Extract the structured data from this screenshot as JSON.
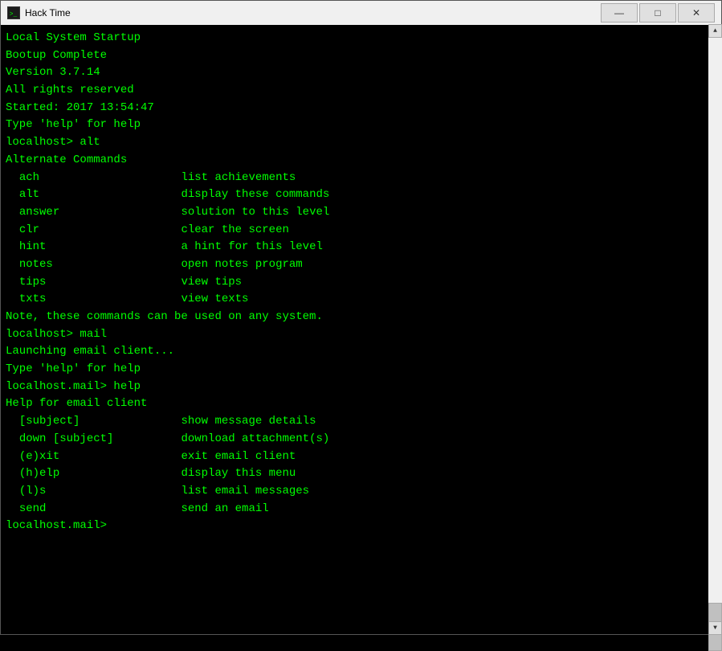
{
  "window": {
    "title": "Hack Time",
    "icon": "terminal-icon"
  },
  "titlebar": {
    "minimize_label": "—",
    "maximize_label": "□",
    "close_label": "✕"
  },
  "terminal": {
    "content": "Local System Startup\nBootup Complete\nVersion 3.7.14\nAll rights reserved\nStarted: 2017 13:54:47\nType 'help' for help\nlocalhost> alt\nAlternate Commands\n  ach                     list achievements\n  alt                     display these commands\n  answer                  solution to this level\n  clr                     clear the screen\n  hint                    a hint for this level\n  notes                   open notes program\n  tips                    view tips\n  txts                    view texts\nNote, these commands can be used on any system.\nlocalhost> mail\nLaunching email client...\nType 'help' for help\nlocalhost.mail> help\nHelp for email client\n  [subject]               show message details\n  down [subject]          download attachment(s)\n  (e)xit                  exit email client\n  (h)elp                  display this menu\n  (l)s                    list email messages\n  send                    send an email\nlocalhost.mail> "
  },
  "colors": {
    "terminal_bg": "#000000",
    "terminal_text": "#00ff00",
    "titlebar_bg": "#f0f0f0"
  }
}
